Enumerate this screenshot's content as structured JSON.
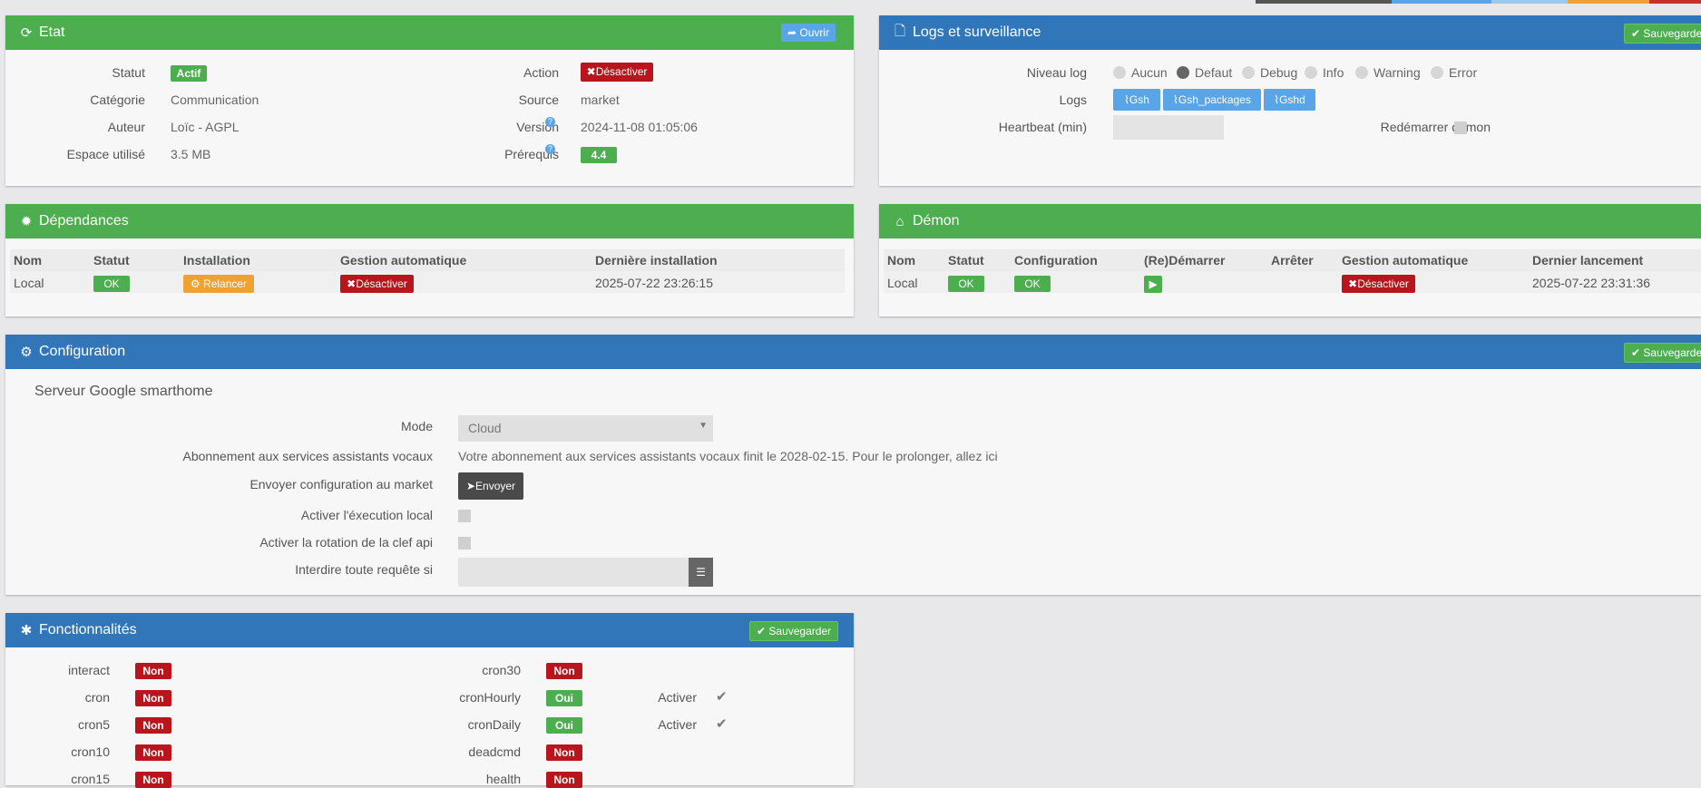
{
  "colors": {
    "green": "#4cae4f",
    "blue": "#3176b8",
    "red": "#c9302c",
    "orange": "#f0a133",
    "light_blue": "#5aa4e8"
  },
  "etat": {
    "title": "Etat",
    "open_button": "Ouvrir",
    "statut_label": "Statut",
    "statut_value": "Actif",
    "categorie_label": "Catégorie",
    "categorie_value": "Communication",
    "auteur_label": "Auteur",
    "auteur_value": "Loïc - AGPL",
    "espace_label": "Espace utilisé",
    "espace_value": "3.5 MB",
    "action_label": "Action",
    "action_button": "Désactiver",
    "source_label": "Source",
    "source_value": "market",
    "version_label": "Version",
    "version_value": "2024-11-08 01:05:06",
    "prerequis_label": "Prérequis",
    "prerequis_value": "4.4"
  },
  "logs": {
    "title": "Logs et surveillance",
    "save_button": "Sauvegarder",
    "niveau_label": "Niveau log",
    "levels": [
      "Aucun",
      "Defaut",
      "Debug",
      "Info",
      "Warning",
      "Error"
    ],
    "selected_level": "Defaut",
    "logs_label": "Logs",
    "log_buttons": [
      "Gsh",
      "Gsh_packages",
      "Gshd"
    ],
    "heartbeat_label": "Heartbeat (min)",
    "heartbeat_value": "",
    "restart_label": "Redémarrer démon"
  },
  "dependances": {
    "title": "Dépendances",
    "headers": [
      "Nom",
      "Statut",
      "Installation",
      "Gestion automatique",
      "Dernière installation"
    ],
    "row": {
      "nom": "Local",
      "statut": "OK",
      "installation": "Relancer",
      "gestion": "Désactiver",
      "derniere": "2025-07-22 23:26:15"
    }
  },
  "demon": {
    "title": "Démon",
    "headers": [
      "Nom",
      "Statut",
      "Configuration",
      "(Re)Démarrer",
      "Arrêter",
      "Gestion automatique",
      "Dernier lancement"
    ],
    "row": {
      "nom": "Local",
      "statut": "OK",
      "configuration": "OK",
      "gestion": "Désactiver",
      "dernier": "2025-07-22 23:31:36"
    }
  },
  "configuration": {
    "title": "Configuration",
    "save_button": "Sauvegarder",
    "section_title": "Serveur Google smarthome",
    "mode_label": "Mode",
    "mode_value": "Cloud",
    "abonnement_label": "Abonnement aux services assistants vocaux",
    "abonnement_value": "Votre abonnement aux services assistants vocaux finit le 2028-02-15. Pour le prolonger, allez ici",
    "envoyer_label": "Envoyer configuration au market",
    "envoyer_button": "Envoyer",
    "local_label": "Activer l'éxecution local",
    "rotation_label": "Activer la rotation de la clef api",
    "interdire_label": "Interdire toute requête si",
    "interdire_value": ""
  },
  "fonctionnalites": {
    "title": "Fonctionnalités",
    "save_button": "Sauvegarder",
    "activer_label": "Activer",
    "left": [
      {
        "name": "interact",
        "value": "Non"
      },
      {
        "name": "cron",
        "value": "Non"
      },
      {
        "name": "cron5",
        "value": "Non"
      },
      {
        "name": "cron10",
        "value": "Non"
      },
      {
        "name": "cron15",
        "value": "Non"
      }
    ],
    "right": [
      {
        "name": "cron30",
        "value": "Non"
      },
      {
        "name": "cronHourly",
        "value": "Oui",
        "activer": true
      },
      {
        "name": "cronDaily",
        "value": "Oui",
        "activer": true
      },
      {
        "name": "deadcmd",
        "value": "Non"
      },
      {
        "name": "health",
        "value": "Non"
      }
    ]
  }
}
